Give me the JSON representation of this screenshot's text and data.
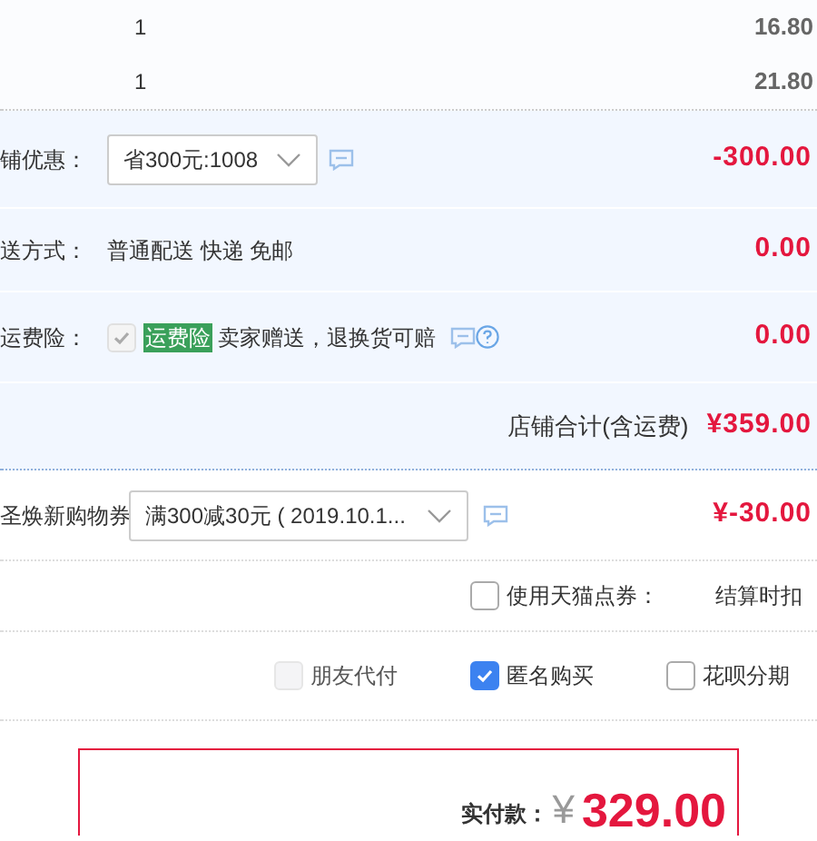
{
  "items": [
    {
      "quantity": "1",
      "price": "16.80"
    },
    {
      "quantity": "1",
      "price": "21.80"
    }
  ],
  "shop_discount": {
    "label": "铺优惠：",
    "select_value": "省300元:1008",
    "amount": "-300.00"
  },
  "delivery": {
    "label": "送方式：",
    "value": "普通配送 快递 免邮",
    "amount": "0.00"
  },
  "shipping_insurance": {
    "label": "运费险：",
    "checked": true,
    "disabled": true,
    "tag": "运费险",
    "text": "卖家赠送，退换货可赔",
    "amount": "0.00"
  },
  "shop_total": {
    "label": "店铺合计(含运费)",
    "amount": "¥359.00"
  },
  "coupon": {
    "label": "圣焕新购物券",
    "select_value": "满300减30元 ( 2019.10.1...",
    "amount": "¥-30.00"
  },
  "points": {
    "label": "使用天猫点券：",
    "checked": false,
    "note": "结算时扣"
  },
  "options": [
    {
      "label": "朋友代付",
      "checked": false,
      "disabled": true
    },
    {
      "label": "匿名购买",
      "checked": true,
      "disabled": false
    },
    {
      "label": "花呗分期",
      "checked": false,
      "disabled": false
    }
  ],
  "payment": {
    "label": "实付款：",
    "currency": "¥",
    "amount": "329.00"
  }
}
